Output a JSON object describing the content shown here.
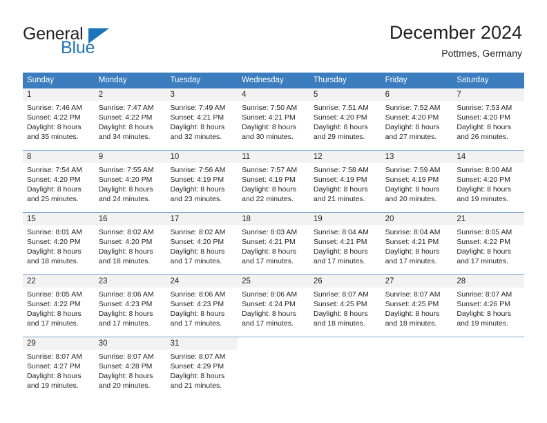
{
  "brand": {
    "name_part1": "General",
    "name_part2": "Blue"
  },
  "header": {
    "title": "December 2024",
    "subtitle": "Pottmes, Germany"
  },
  "colors": {
    "header_blue": "#3b7dbf",
    "brand_blue": "#1b75bb",
    "daynum_band": "#f2f2f2",
    "grid_line": "#7ea7cf",
    "text": "#231f20"
  },
  "weekdays": [
    "Sunday",
    "Monday",
    "Tuesday",
    "Wednesday",
    "Thursday",
    "Friday",
    "Saturday"
  ],
  "weeks": [
    [
      {
        "day": "1",
        "sunrise": "Sunrise: 7:46 AM",
        "sunset": "Sunset: 4:22 PM",
        "daylight1": "Daylight: 8 hours",
        "daylight2": "and 35 minutes."
      },
      {
        "day": "2",
        "sunrise": "Sunrise: 7:47 AM",
        "sunset": "Sunset: 4:22 PM",
        "daylight1": "Daylight: 8 hours",
        "daylight2": "and 34 minutes."
      },
      {
        "day": "3",
        "sunrise": "Sunrise: 7:49 AM",
        "sunset": "Sunset: 4:21 PM",
        "daylight1": "Daylight: 8 hours",
        "daylight2": "and 32 minutes."
      },
      {
        "day": "4",
        "sunrise": "Sunrise: 7:50 AM",
        "sunset": "Sunset: 4:21 PM",
        "daylight1": "Daylight: 8 hours",
        "daylight2": "and 30 minutes."
      },
      {
        "day": "5",
        "sunrise": "Sunrise: 7:51 AM",
        "sunset": "Sunset: 4:20 PM",
        "daylight1": "Daylight: 8 hours",
        "daylight2": "and 29 minutes."
      },
      {
        "day": "6",
        "sunrise": "Sunrise: 7:52 AM",
        "sunset": "Sunset: 4:20 PM",
        "daylight1": "Daylight: 8 hours",
        "daylight2": "and 27 minutes."
      },
      {
        "day": "7",
        "sunrise": "Sunrise: 7:53 AM",
        "sunset": "Sunset: 4:20 PM",
        "daylight1": "Daylight: 8 hours",
        "daylight2": "and 26 minutes."
      }
    ],
    [
      {
        "day": "8",
        "sunrise": "Sunrise: 7:54 AM",
        "sunset": "Sunset: 4:20 PM",
        "daylight1": "Daylight: 8 hours",
        "daylight2": "and 25 minutes."
      },
      {
        "day": "9",
        "sunrise": "Sunrise: 7:55 AM",
        "sunset": "Sunset: 4:20 PM",
        "daylight1": "Daylight: 8 hours",
        "daylight2": "and 24 minutes."
      },
      {
        "day": "10",
        "sunrise": "Sunrise: 7:56 AM",
        "sunset": "Sunset: 4:19 PM",
        "daylight1": "Daylight: 8 hours",
        "daylight2": "and 23 minutes."
      },
      {
        "day": "11",
        "sunrise": "Sunrise: 7:57 AM",
        "sunset": "Sunset: 4:19 PM",
        "daylight1": "Daylight: 8 hours",
        "daylight2": "and 22 minutes."
      },
      {
        "day": "12",
        "sunrise": "Sunrise: 7:58 AM",
        "sunset": "Sunset: 4:19 PM",
        "daylight1": "Daylight: 8 hours",
        "daylight2": "and 21 minutes."
      },
      {
        "day": "13",
        "sunrise": "Sunrise: 7:59 AM",
        "sunset": "Sunset: 4:19 PM",
        "daylight1": "Daylight: 8 hours",
        "daylight2": "and 20 minutes."
      },
      {
        "day": "14",
        "sunrise": "Sunrise: 8:00 AM",
        "sunset": "Sunset: 4:20 PM",
        "daylight1": "Daylight: 8 hours",
        "daylight2": "and 19 minutes."
      }
    ],
    [
      {
        "day": "15",
        "sunrise": "Sunrise: 8:01 AM",
        "sunset": "Sunset: 4:20 PM",
        "daylight1": "Daylight: 8 hours",
        "daylight2": "and 18 minutes."
      },
      {
        "day": "16",
        "sunrise": "Sunrise: 8:02 AM",
        "sunset": "Sunset: 4:20 PM",
        "daylight1": "Daylight: 8 hours",
        "daylight2": "and 18 minutes."
      },
      {
        "day": "17",
        "sunrise": "Sunrise: 8:02 AM",
        "sunset": "Sunset: 4:20 PM",
        "daylight1": "Daylight: 8 hours",
        "daylight2": "and 17 minutes."
      },
      {
        "day": "18",
        "sunrise": "Sunrise: 8:03 AM",
        "sunset": "Sunset: 4:21 PM",
        "daylight1": "Daylight: 8 hours",
        "daylight2": "and 17 minutes."
      },
      {
        "day": "19",
        "sunrise": "Sunrise: 8:04 AM",
        "sunset": "Sunset: 4:21 PM",
        "daylight1": "Daylight: 8 hours",
        "daylight2": "and 17 minutes."
      },
      {
        "day": "20",
        "sunrise": "Sunrise: 8:04 AM",
        "sunset": "Sunset: 4:21 PM",
        "daylight1": "Daylight: 8 hours",
        "daylight2": "and 17 minutes."
      },
      {
        "day": "21",
        "sunrise": "Sunrise: 8:05 AM",
        "sunset": "Sunset: 4:22 PM",
        "daylight1": "Daylight: 8 hours",
        "daylight2": "and 17 minutes."
      }
    ],
    [
      {
        "day": "22",
        "sunrise": "Sunrise: 8:05 AM",
        "sunset": "Sunset: 4:22 PM",
        "daylight1": "Daylight: 8 hours",
        "daylight2": "and 17 minutes."
      },
      {
        "day": "23",
        "sunrise": "Sunrise: 8:06 AM",
        "sunset": "Sunset: 4:23 PM",
        "daylight1": "Daylight: 8 hours",
        "daylight2": "and 17 minutes."
      },
      {
        "day": "24",
        "sunrise": "Sunrise: 8:06 AM",
        "sunset": "Sunset: 4:23 PM",
        "daylight1": "Daylight: 8 hours",
        "daylight2": "and 17 minutes."
      },
      {
        "day": "25",
        "sunrise": "Sunrise: 8:06 AM",
        "sunset": "Sunset: 4:24 PM",
        "daylight1": "Daylight: 8 hours",
        "daylight2": "and 17 minutes."
      },
      {
        "day": "26",
        "sunrise": "Sunrise: 8:07 AM",
        "sunset": "Sunset: 4:25 PM",
        "daylight1": "Daylight: 8 hours",
        "daylight2": "and 18 minutes."
      },
      {
        "day": "27",
        "sunrise": "Sunrise: 8:07 AM",
        "sunset": "Sunset: 4:25 PM",
        "daylight1": "Daylight: 8 hours",
        "daylight2": "and 18 minutes."
      },
      {
        "day": "28",
        "sunrise": "Sunrise: 8:07 AM",
        "sunset": "Sunset: 4:26 PM",
        "daylight1": "Daylight: 8 hours",
        "daylight2": "and 19 minutes."
      }
    ],
    [
      {
        "day": "29",
        "sunrise": "Sunrise: 8:07 AM",
        "sunset": "Sunset: 4:27 PM",
        "daylight1": "Daylight: 8 hours",
        "daylight2": "and 19 minutes."
      },
      {
        "day": "30",
        "sunrise": "Sunrise: 8:07 AM",
        "sunset": "Sunset: 4:28 PM",
        "daylight1": "Daylight: 8 hours",
        "daylight2": "and 20 minutes."
      },
      {
        "day": "31",
        "sunrise": "Sunrise: 8:07 AM",
        "sunset": "Sunset: 4:29 PM",
        "daylight1": "Daylight: 8 hours",
        "daylight2": "and 21 minutes."
      },
      {
        "day": "",
        "sunrise": "",
        "sunset": "",
        "daylight1": "",
        "daylight2": ""
      },
      {
        "day": "",
        "sunrise": "",
        "sunset": "",
        "daylight1": "",
        "daylight2": ""
      },
      {
        "day": "",
        "sunrise": "",
        "sunset": "",
        "daylight1": "",
        "daylight2": ""
      },
      {
        "day": "",
        "sunrise": "",
        "sunset": "",
        "daylight1": "",
        "daylight2": ""
      }
    ]
  ]
}
